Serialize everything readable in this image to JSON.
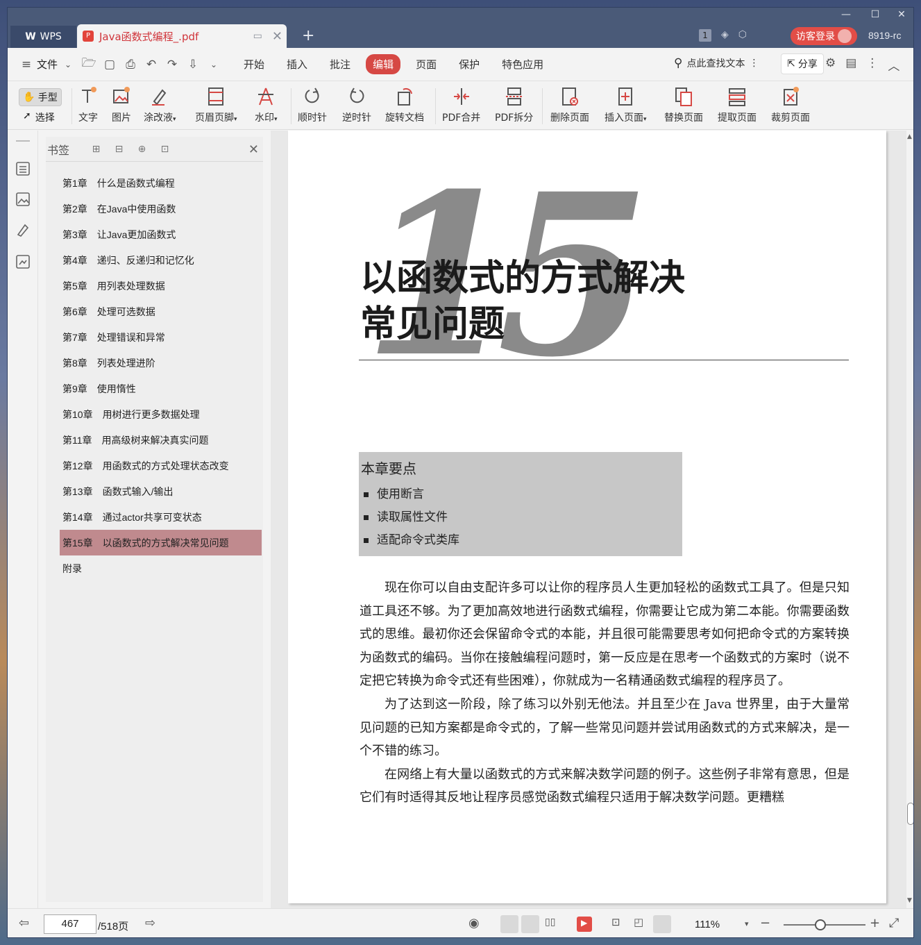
{
  "titlebar": {
    "app_tab": "WPS",
    "doc_tab": "Java函数式编程_.pdf",
    "login": "访客登录",
    "version": "8919-rc",
    "badge": "1"
  },
  "menubar": {
    "file": "文件",
    "items": [
      "开始",
      "插入",
      "批注",
      "编辑",
      "页面",
      "保护",
      "特色应用"
    ],
    "active": "编辑",
    "search": "点此查找文本",
    "share": "分享"
  },
  "ribbon": {
    "hand": "手型",
    "select": "选择",
    "tools": [
      "文字",
      "图片",
      "涂改液",
      "页眉页脚",
      "水印",
      "顺时针",
      "逆时针",
      "旋转文档",
      "PDF合并",
      "PDF拆分",
      "删除页面",
      "插入页面",
      "替换页面",
      "提取页面",
      "裁剪页面"
    ]
  },
  "panel": {
    "title": "书签",
    "bookmarks": [
      "第1章　什么是函数式编程",
      "第2章　在Java中使用函数",
      "第3章　让Java更加函数式",
      "第4章　递归、反递归和记忆化",
      "第5章　用列表处理数据",
      "第6章　处理可选数据",
      "第7章　处理错误和异常",
      "第8章　列表处理进阶",
      "第9章　使用惰性",
      "第10章　用树进行更多数据处理",
      "第11章　用高级树来解决真实问题",
      "第12章　用函数式的方式处理状态改变",
      "第13章　函数式输入/输出",
      "第14章　通过actor共享可变状态",
      "第15章　以函数式的方式解决常见问题",
      "附录"
    ],
    "selected_index": 14
  },
  "document": {
    "chapter_number": "15",
    "chapter_title_line1": "以函数式的方式解决",
    "chapter_title_line2": "常见问题",
    "key_points_title": "本章要点",
    "key_points": [
      "使用断言",
      "读取属性文件",
      "适配命令式类库"
    ],
    "paragraphs": [
      "现在你可以自由支配许多可以让你的程序员人生更加轻松的函数式工具了。但是只知道工具还不够。为了更加高效地进行函数式编程，你需要让它成为第二本能。你需要函数式的思维。最初你还会保留命令式的本能，并且很可能需要思考如何把命令式的方案转换为函数式的编码。当你在接触编程问题时，第一反应是在思考一个函数式的方案时（说不定把它转换为命令式还有些困难），你就成为一名精通函数式编程的程序员了。",
      "为了达到这一阶段，除了练习以外别无他法。并且至少在 Java 世界里，由于大量常见问题的已知方案都是命令式的，了解一些常见问题并尝试用函数式的方式来解决，是一个不错的练习。",
      "在网络上有大量以函数式的方式来解决数学问题的例子。这些例子非常有意思，但是它们有时适得其反地让程序员感觉函数式编程只适用于解决数学问题。更糟糕"
    ]
  },
  "status": {
    "page_current": "467",
    "page_total": "/518页",
    "zoom": "111%"
  }
}
